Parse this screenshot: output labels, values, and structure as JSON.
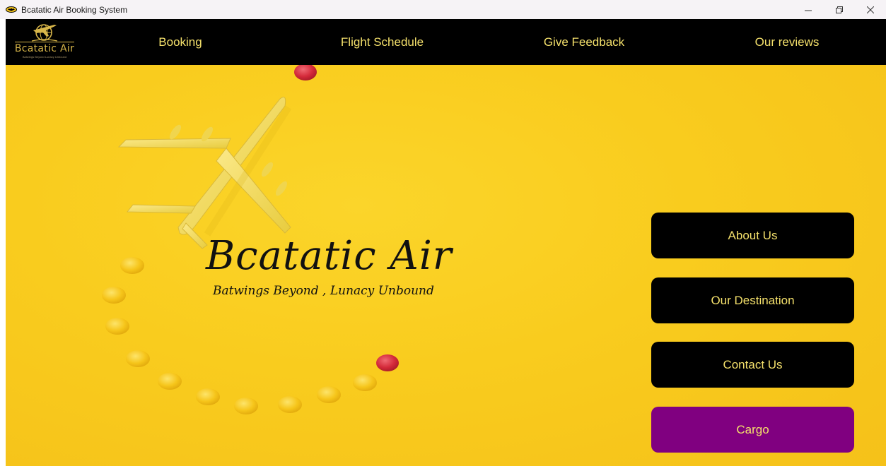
{
  "window": {
    "title": "Bcatatic Air Booking System",
    "controls": {
      "minimize": "–",
      "restore": "❐",
      "close": "✕"
    }
  },
  "logo": {
    "name": "Bcatatic Air",
    "tagline": "Batwings Beyond Lunacy Unbound"
  },
  "nav": {
    "items": [
      {
        "label": "Booking"
      },
      {
        "label": "Flight Schedule"
      },
      {
        "label": "Give Feedback"
      },
      {
        "label": "Our reviews"
      }
    ]
  },
  "hero": {
    "title": "Bcatatic Air",
    "tagline": "Batwings Beyond , Lunacy Unbound"
  },
  "side_buttons": [
    {
      "label": "About Us"
    },
    {
      "label": "Our Destination"
    },
    {
      "label": "Contact Us"
    },
    {
      "label": "Cargo"
    }
  ],
  "colors": {
    "nav_bg": "#000000",
    "nav_text": "#f4e06b",
    "hero_bg": "#f9cc1e",
    "button_dark": "#000000",
    "button_cargo": "#800080",
    "candy_yellow": "#f6c51a",
    "candy_red": "#d42a3a"
  },
  "icons": {
    "app": "bat-icon",
    "logo": "plane-globe-icon"
  }
}
